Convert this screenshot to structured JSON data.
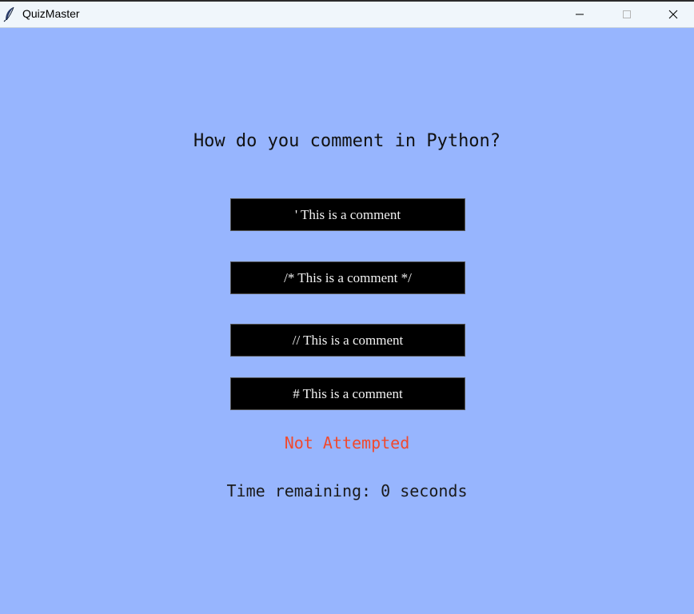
{
  "window": {
    "title": "QuizMaster",
    "icon": "feather-icon"
  },
  "quiz": {
    "question": "How do you comment in Python?",
    "options": [
      "' This is a comment",
      "/* This is a comment */",
      "// This is a comment",
      "# This is a comment"
    ],
    "status": "Not Attempted",
    "timer": "Time remaining: 0 seconds"
  },
  "colors": {
    "background": "#97b5fe",
    "option_bg": "#000000",
    "option_text": "#f2f2f2",
    "status": "#f04a2e"
  }
}
